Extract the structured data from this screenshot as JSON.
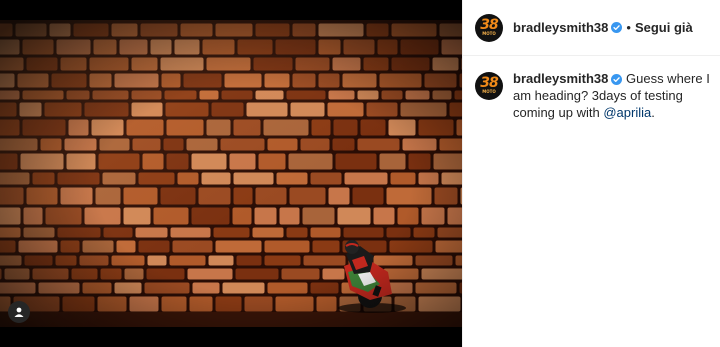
{
  "post": {
    "media": {
      "alt": "Motorcycle rider leaning against a stone wall",
      "colors": {
        "wall_dark": "#2a0d05",
        "wall_mid": "#8a3a14",
        "wall_light": "#c7764a",
        "bike_red": "#c2281e",
        "bike_green": "#2f8a3a"
      },
      "tag_icon": "user-tag-icon"
    },
    "header": {
      "username": "bradleysmith38",
      "verified_icon": "verified-badge-icon",
      "separator": "•",
      "follow_label": "Segui già",
      "avatar": {
        "number": "38",
        "sub": "MOTO",
        "bg": "#111111",
        "accent": "#f08a1a"
      }
    },
    "caption": {
      "username": "bradleysmith38",
      "text_before": "Guess where I am heading? 3days of testing coming up with ",
      "mention": "@aprilia",
      "text_after": "."
    }
  }
}
